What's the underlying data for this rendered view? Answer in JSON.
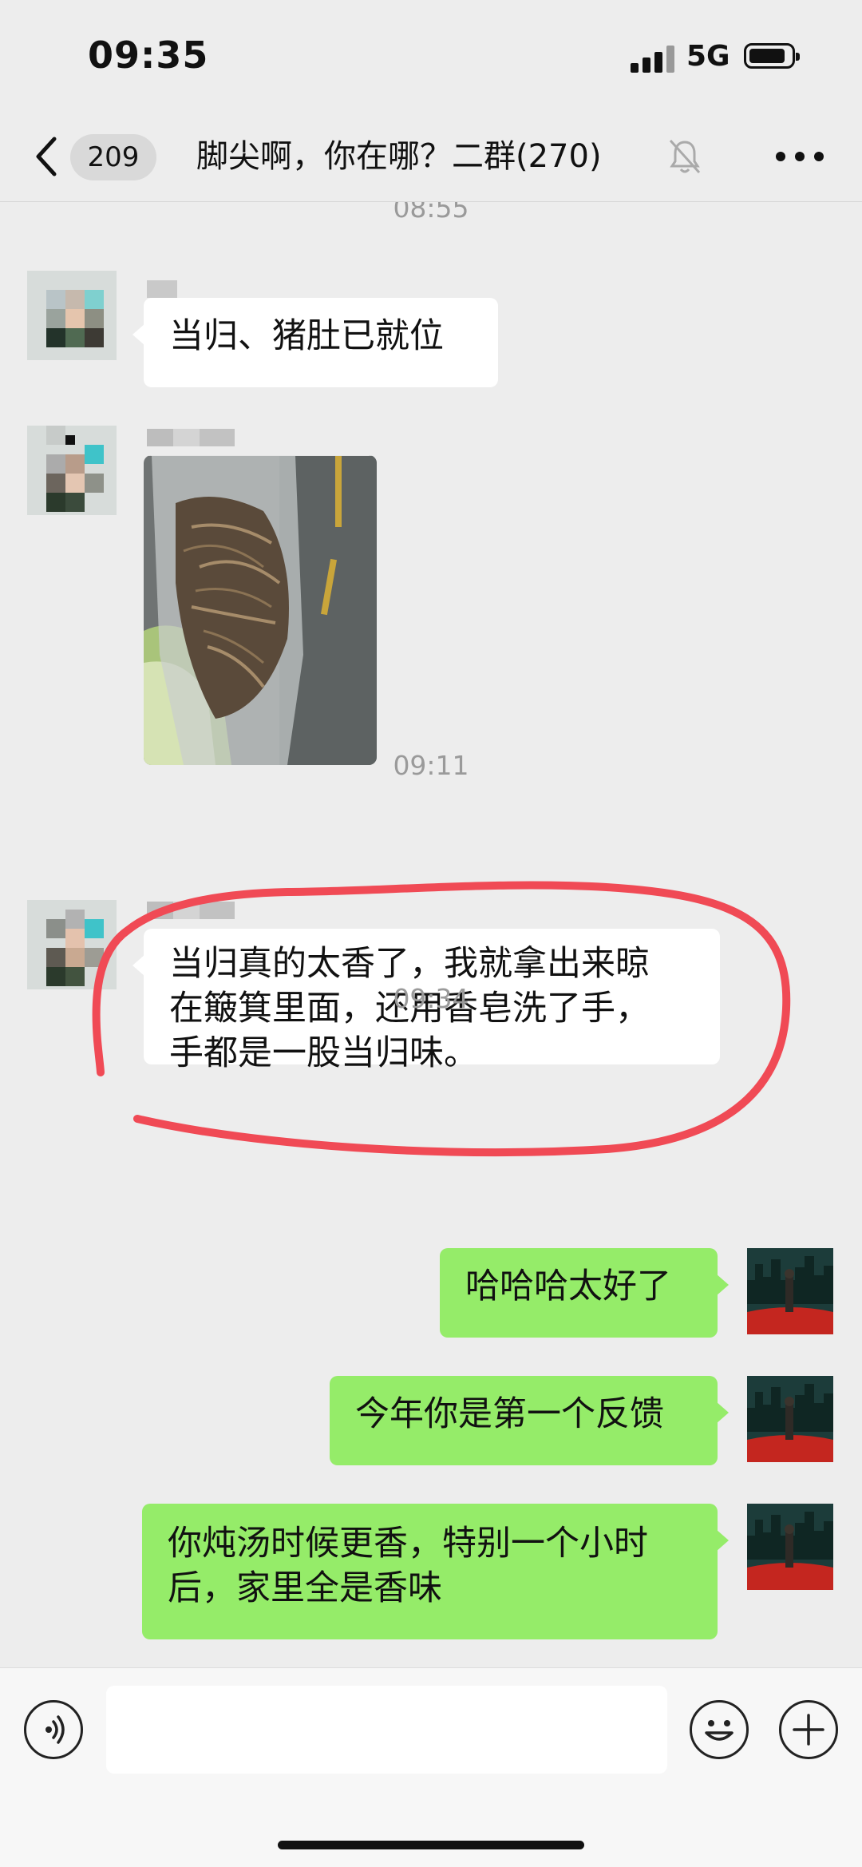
{
  "status": {
    "time": "09:35",
    "network": "5G"
  },
  "header": {
    "back_count": "209",
    "title": "脚尖啊，你在哪？二群(270)"
  },
  "chat": {
    "timestamps": [
      "08:55",
      "09:11",
      "09:34"
    ],
    "messages": [
      {
        "side": "left",
        "type": "text",
        "text": "当归、猪肚已就位"
      },
      {
        "side": "left",
        "type": "image",
        "description": ""
      },
      {
        "side": "left",
        "type": "text",
        "text": "当归真的太香了，我就拿出来晾在簸箕里面，还用香皂洗了手，手都是一股当归味。",
        "lines": [
          "当归真的太香了，我就拿出来晾",
          "在簸箕里面，还用香皂洗了手，",
          "手都是一股当归味。"
        ]
      },
      {
        "side": "right",
        "type": "text",
        "text": "哈哈哈太好了"
      },
      {
        "side": "right",
        "type": "text",
        "text": "今年你是第一个反馈"
      },
      {
        "side": "right",
        "type": "text",
        "text": "你炖汤时候更香，特别一个小时后，家里全是香味",
        "lines": [
          "你炖汤时候更香，特别一个小时",
          "后，家里全是香味"
        ]
      }
    ]
  },
  "colors": {
    "background": "#ededed",
    "my_bubble": "#95ec69",
    "their_bubble": "#ffffff",
    "annotation": "#f04a55"
  },
  "icons": [
    "chevron-left",
    "mute-bell",
    "more-dots",
    "voice",
    "emoji",
    "plus"
  ]
}
